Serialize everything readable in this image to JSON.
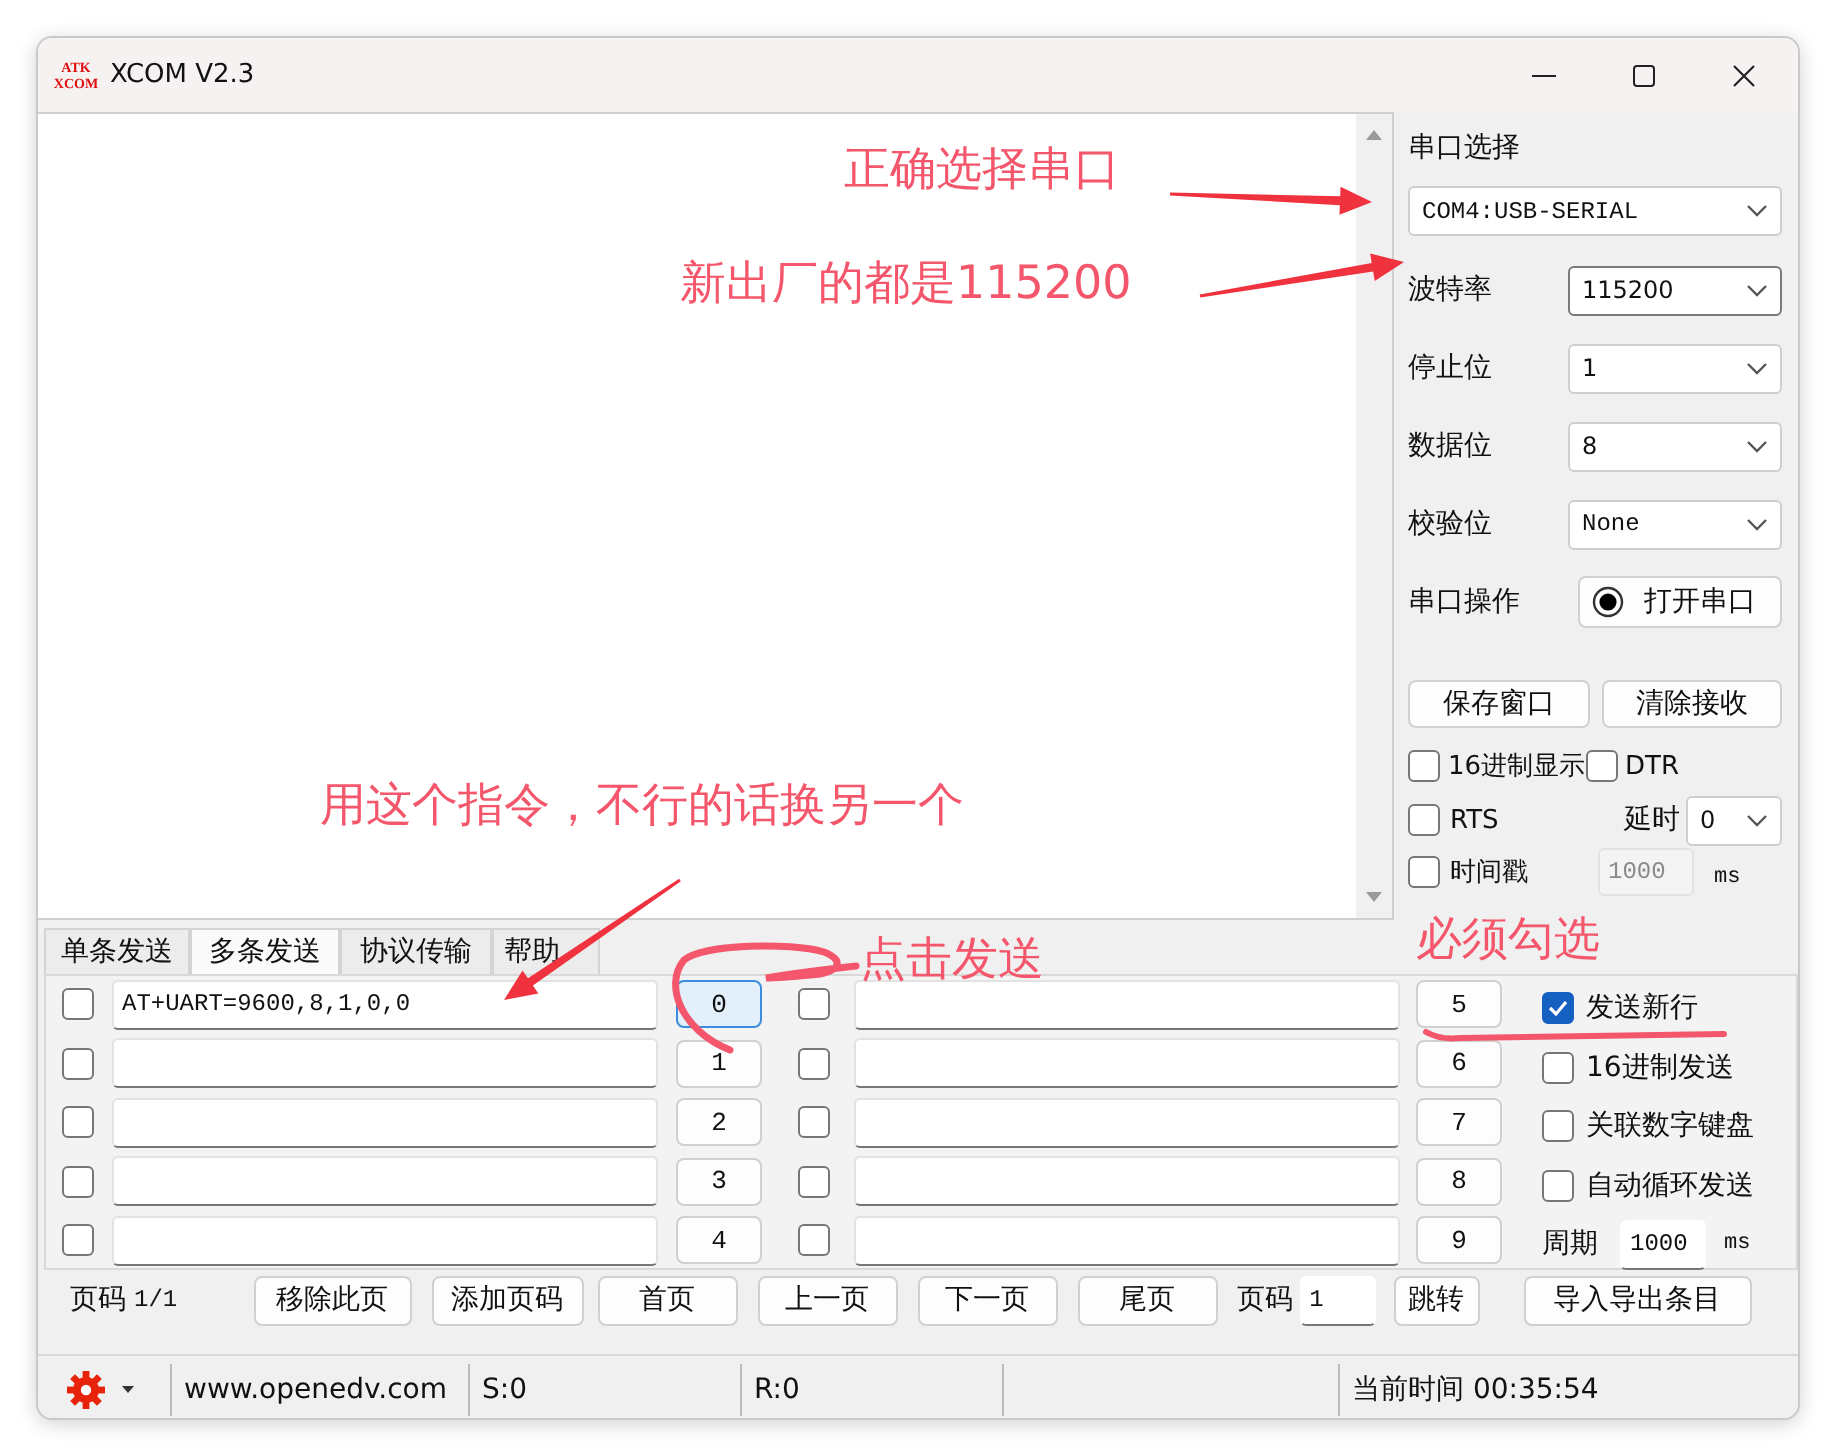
{
  "window": {
    "title": "XCOM V2.3",
    "logo": {
      "top": "ATK",
      "bottom": "XCOM"
    }
  },
  "serial_panel": {
    "title": "串口选择",
    "port": "COM4:USB-SERIAL",
    "settings": [
      {
        "label": "波特率",
        "value": "115200",
        "focused": true
      },
      {
        "label": "停止位",
        "value": "1",
        "focused": false
      },
      {
        "label": "数据位",
        "value": "8",
        "focused": false
      },
      {
        "label": "校验位",
        "value": "None",
        "focused": false
      }
    ],
    "operation_label": "串口操作",
    "open_button": "打开串口",
    "buttons": [
      "保存窗口",
      "清除接收"
    ],
    "options": [
      {
        "label": "16进制显示",
        "checked": false
      },
      {
        "label": "DTR",
        "checked": false
      },
      {
        "label": "RTS",
        "checked": false
      },
      {
        "label": "时间戳",
        "checked": false
      }
    ],
    "delay_label": "延时",
    "delay_value": "0",
    "timestamp_interval": "1000",
    "timestamp_unit": "ms"
  },
  "send_tabs": [
    {
      "label": "单条发送",
      "selected": false
    },
    {
      "label": "多条发送",
      "selected": true
    },
    {
      "label": "协议传输",
      "selected": false
    },
    {
      "label": "帮助",
      "selected": false
    }
  ],
  "send_rows": [
    {
      "checked": false,
      "value": "AT+UART=9600,8,1,0,0",
      "button": "0",
      "focused": true
    },
    {
      "checked": false,
      "button": "1",
      "focused": false
    },
    {
      "checked": false,
      "button": "2",
      "focused": false
    },
    {
      "checked": false,
      "button": "3",
      "focused": false
    },
    {
      "checked": false,
      "button": "4",
      "focused": false
    },
    {
      "checked": false,
      "button": "5",
      "focused": false
    },
    {
      "checked": false,
      "button": "6",
      "focused": false
    },
    {
      "checked": false,
      "button": "7",
      "focused": false
    },
    {
      "checked": false,
      "button": "8",
      "focused": false
    },
    {
      "checked": false,
      "button": "9",
      "focused": false
    }
  ],
  "send_options": [
    {
      "label": "发送新行",
      "checked": true
    },
    {
      "label": "16进制发送",
      "checked": false
    },
    {
      "label": "关联数字键盘",
      "checked": false
    },
    {
      "label": "自动循环发送",
      "checked": false
    }
  ],
  "period": {
    "label": "周期",
    "value": "1000",
    "unit": "ms"
  },
  "pager": {
    "page_label": "页码",
    "page": "1/1",
    "buttons": [
      "移除此页",
      "添加页码",
      "首页",
      "上一页",
      "下一页",
      "尾页"
    ],
    "goto_label": "页码",
    "goto_value": "1",
    "goto_button": "跳转",
    "export_button": "导入导出条目"
  },
  "status_bar": {
    "website": "www.openedv.com",
    "sent": "S:0",
    "received": "R:0",
    "time_label": "当前时间",
    "time": "00:35:54"
  },
  "annotations": [
    {
      "text": "正确选择串口"
    },
    {
      "text": "新出厂的都是115200"
    },
    {
      "text": "用这个指令，不行的话换另一个"
    },
    {
      "text": "点击发送"
    },
    {
      "text": "必须勾选"
    }
  ]
}
